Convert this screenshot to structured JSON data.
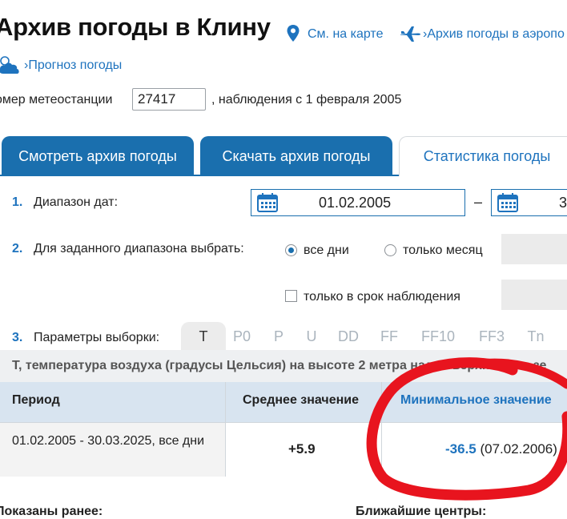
{
  "header": {
    "title": "Архив погоды в Клину",
    "map_link": "См. на карте",
    "airport_link": "Архив погоды в аэропо",
    "forecast_link": "Прогноз погоды",
    "link_marker": "›"
  },
  "station": {
    "label": "омер метеостанции",
    "value": "27417",
    "observations": ", наблюдения с 1 февраля 2005"
  },
  "tabs": [
    {
      "label": "Смотреть архив погоды",
      "active": false
    },
    {
      "label": "Скачать архив погоды",
      "active": false
    },
    {
      "label": "Статистика погоды",
      "active": true
    }
  ],
  "form": {
    "row1": {
      "num": "1.",
      "label": "Диапазон дат:",
      "date_from": "01.02.2005",
      "dash": "–",
      "date_to": "3"
    },
    "row2": {
      "num": "2.",
      "label": "Для заданного диапазона выбрать:",
      "opt_all": "все дни",
      "opt_month": "только месяц",
      "selected": "все дни"
    },
    "row2b": {
      "check_label": "только в срок наблюдения",
      "checked": false
    },
    "row3": {
      "num": "3.",
      "label": "Параметры выборки:",
      "params": [
        "T",
        "P0",
        "P",
        "U",
        "DD",
        "FF",
        "FF10",
        "FF3",
        "Tn"
      ],
      "selected": "T"
    }
  },
  "table": {
    "description": "T, температура воздуха (градусы Цельсия) на высоте 2 метра над поверхностью зе",
    "headers": [
      "Период",
      "Среднее значение",
      "Минимальное значение"
    ],
    "rows": [
      {
        "period": "01.02.2005 - 30.03.2025, все дни",
        "avg": "+5.9",
        "min": "-36.5",
        "min_date": "(07.02.2006)"
      }
    ]
  },
  "footer": {
    "shown_earlier": "Показаны ранее:",
    "nearest": "Ближайшие центры:"
  },
  "colors": {
    "accent": "#1e73be",
    "tab_bg": "#1a6fae",
    "table_header_bg": "#d8e4f0",
    "annotation": "#e8141e"
  },
  "icons": [
    "location-pin-icon",
    "airplane-icon",
    "cloud-icon",
    "calendar-icon"
  ]
}
